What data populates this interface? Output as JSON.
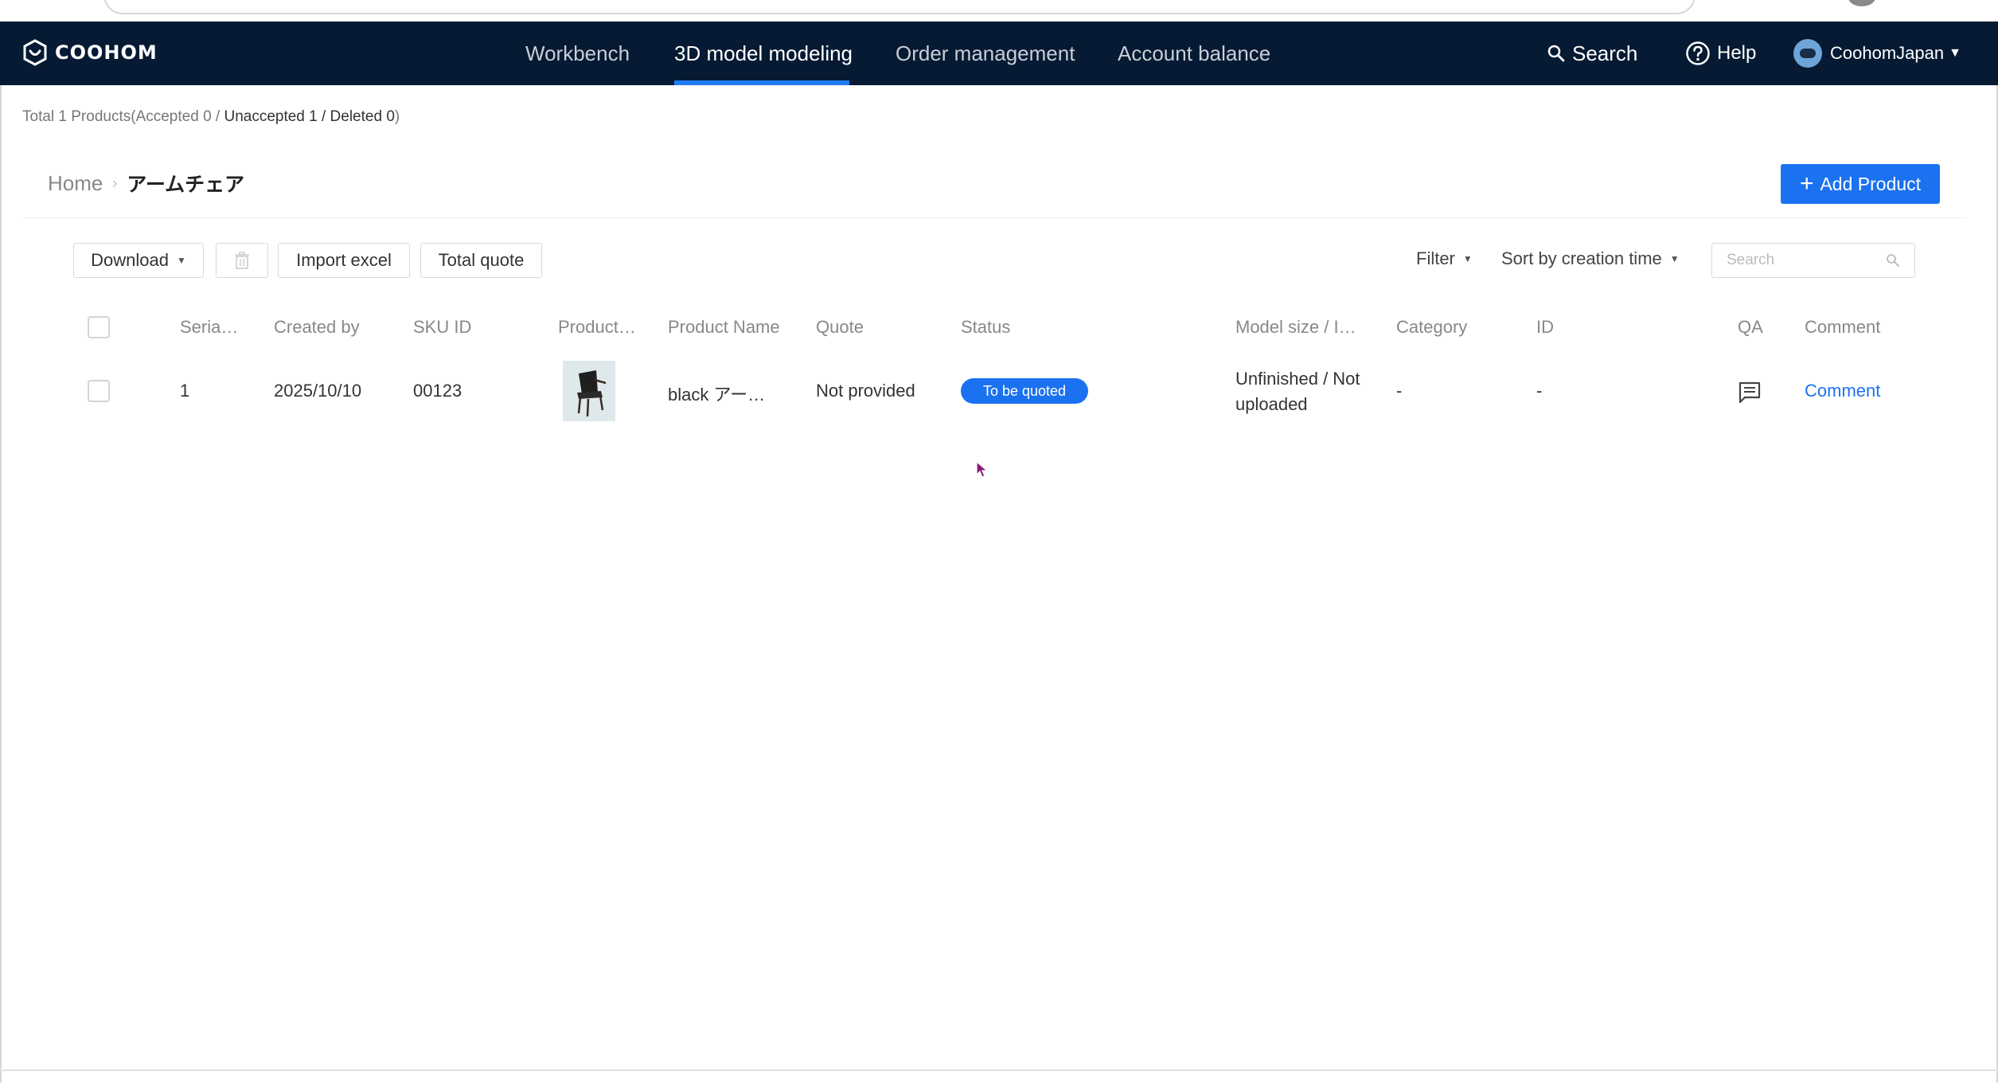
{
  "brand": {
    "name": "COOHOM",
    "nav_bg": "#061a33",
    "accent": "#1b72f0"
  },
  "nav": {
    "items": [
      {
        "label": "Workbench",
        "active": false
      },
      {
        "label": "3D model modeling",
        "active": true
      },
      {
        "label": "Order management",
        "active": false
      },
      {
        "label": "Account balance",
        "active": false
      }
    ],
    "search_label": "Search",
    "help_label": "Help",
    "user_name": "CoohomJapan"
  },
  "summary": {
    "prefix": "Total 1 Products(Accepted 0 / ",
    "unaccepted": "Unaccepted 1 / Deleted 0",
    "suffix": ")"
  },
  "breadcrumb": {
    "home": "Home",
    "separator": "›",
    "current": "アームチェア"
  },
  "add_product_label": "Add Product",
  "toolbar": {
    "download_label": "Download",
    "import_label": "Import excel",
    "total_quote_label": "Total quote",
    "filter_label": "Filter",
    "sort_label": "Sort by creation time",
    "search_placeholder": "Search"
  },
  "table": {
    "columns": [
      "Seria…",
      "Created by",
      "SKU ID",
      "Product…",
      "Product Name",
      "Quote",
      "Status",
      "Model size / I…",
      "Category",
      "ID",
      "QA",
      "Comment"
    ],
    "rows": [
      {
        "serial": "1",
        "created_by": "2025/10/10",
        "sku_id": "00123",
        "product_name": "black アー…",
        "quote": "Not provided",
        "status": "To be quoted",
        "model_size_line1": "Unfinished / Not",
        "model_size_line2": "uploaded",
        "category": "-",
        "id": "-",
        "comment": "Comment",
        "qa_icon": "chat-icon",
        "image_icon": "armchair-thumbnail"
      }
    ]
  }
}
